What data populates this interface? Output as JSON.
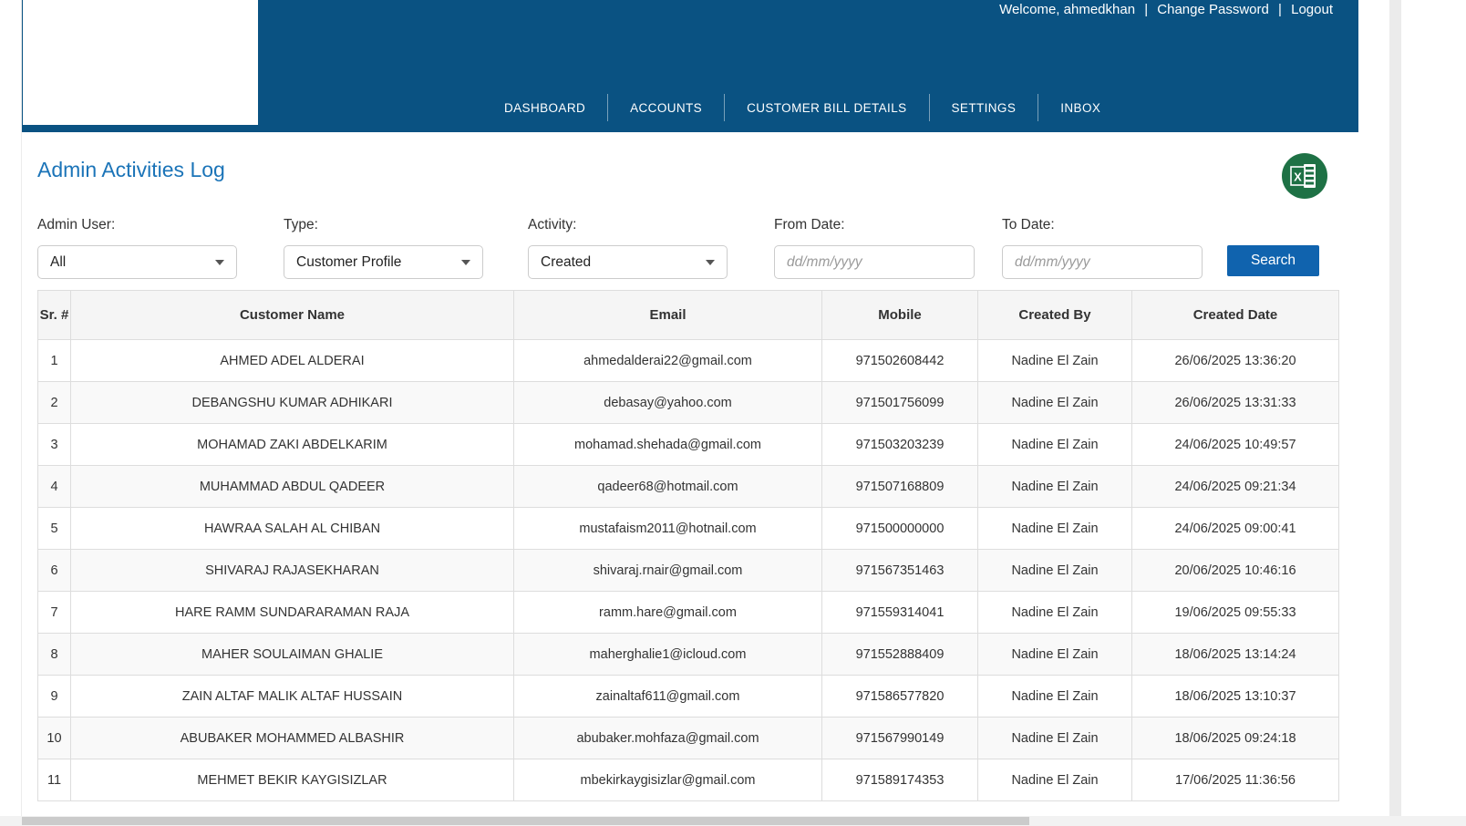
{
  "topbar": {
    "welcome": "Welcome, ahmedkhan",
    "separator": "|",
    "change_password": "Change Password",
    "logout": "Logout"
  },
  "nav": {
    "items": [
      "DASHBOARD",
      "ACCOUNTS",
      "CUSTOMER BILL DETAILS",
      "SETTINGS",
      "INBOX"
    ]
  },
  "page": {
    "title": "Admin Activities Log"
  },
  "icons": {
    "export_excel": "excel-export-icon"
  },
  "filters": {
    "admin_user": {
      "label": "Admin User:",
      "value": "All"
    },
    "type": {
      "label": "Type:",
      "value": "Customer Profile"
    },
    "activity": {
      "label": "Activity:",
      "value": "Created"
    },
    "from_date": {
      "label": "From Date:",
      "placeholder": "dd/mm/yyyy",
      "value": ""
    },
    "to_date": {
      "label": "To Date:",
      "placeholder": "dd/mm/yyyy",
      "value": ""
    },
    "search_label": "Search"
  },
  "table": {
    "headers": [
      "Sr. #",
      "Customer Name",
      "Email",
      "Mobile",
      "Created By",
      "Created Date"
    ],
    "rows": [
      [
        "1",
        "AHMED ADEL ALDERAI",
        "ahmedalderai22@gmail.com",
        "971502608442",
        "Nadine El Zain",
        "26/06/2025 13:36:20"
      ],
      [
        "2",
        "DEBANGSHU KUMAR ADHIKARI",
        "debasay@yahoo.com",
        "971501756099",
        "Nadine El Zain",
        "26/06/2025 13:31:33"
      ],
      [
        "3",
        "MOHAMAD ZAKI ABDELKARIM",
        "mohamad.shehada@gmail.com",
        "971503203239",
        "Nadine El Zain",
        "24/06/2025 10:49:57"
      ],
      [
        "4",
        "MUHAMMAD ABDUL QADEER",
        "qadeer68@hotmail.com",
        "971507168809",
        "Nadine El Zain",
        "24/06/2025 09:21:34"
      ],
      [
        "5",
        "HAWRAA SALAH AL CHIBAN",
        "mustafaism2011@hotnail.com",
        "971500000000",
        "Nadine El Zain",
        "24/06/2025 09:00:41"
      ],
      [
        "6",
        "SHIVARAJ RAJASEKHARAN",
        "shivaraj.rnair@gmail.com",
        "971567351463",
        "Nadine El Zain",
        "20/06/2025 10:46:16"
      ],
      [
        "7",
        "HARE RAMM SUNDARARAMAN RAJA",
        "ramm.hare@gmail.com",
        "971559314041",
        "Nadine El Zain",
        "19/06/2025 09:55:33"
      ],
      [
        "8",
        "MAHER SOULAIMAN GHALIE",
        "maherghalie1@icloud.com",
        "971552888409",
        "Nadine El Zain",
        "18/06/2025 13:14:24"
      ],
      [
        "9",
        "ZAIN ALTAF MALIK ALTAF HUSSAIN",
        "zainaltaf611@gmail.com",
        "971586577820",
        "Nadine El Zain",
        "18/06/2025 13:10:37"
      ],
      [
        "10",
        "ABUBAKER MOHAMMED ALBASHIR",
        "abubaker.mohfaza@gmail.com",
        "971567990149",
        "Nadine El Zain",
        "18/06/2025 09:24:18"
      ],
      [
        "11",
        "MEHMET BEKIR KAYGISIZLAR",
        "mbekirkaygisizlar@gmail.com",
        "971589174353",
        "Nadine El Zain",
        "17/06/2025 11:36:56"
      ]
    ]
  },
  "colors": {
    "header_blue": "#0a5282",
    "title_blue": "#1b74b8",
    "button_blue": "#1063ae",
    "excel_green": "#1e7145",
    "table_header_bg": "#f5f5f5",
    "row_alt_bg": "#f9f9f9",
    "border_gray": "#dddddd"
  }
}
